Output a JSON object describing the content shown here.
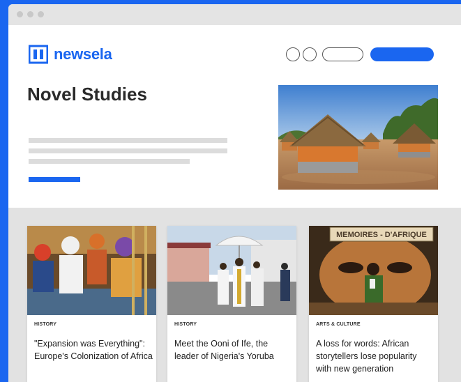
{
  "brand": {
    "name": "newsela",
    "color": "#1a66f0"
  },
  "header": {
    "nav_controls": [
      "circle-button",
      "circle-button",
      "outline-pill-button",
      "primary-pill-button"
    ]
  },
  "hero": {
    "title": "Novel Studies",
    "image": "thatched-roof-round-huts"
  },
  "cards": [
    {
      "category": "HISTORY",
      "title": "\"Expansion was Everything\": Europe's Colonization of Africa",
      "image": "colonial-era-painting"
    },
    {
      "category": "HISTORY",
      "title": "Meet the Ooni of Ife, the leader of Nigeria's Yoruba",
      "image": "procession-under-white-umbrella"
    },
    {
      "category": "ARTS & CULTURE",
      "title": "A loss for words: African storytellers lose popularity with new generation",
      "image": "storyteller-on-stage",
      "image_sign": "MEMOIRES - D'AFRIQUE"
    }
  ]
}
